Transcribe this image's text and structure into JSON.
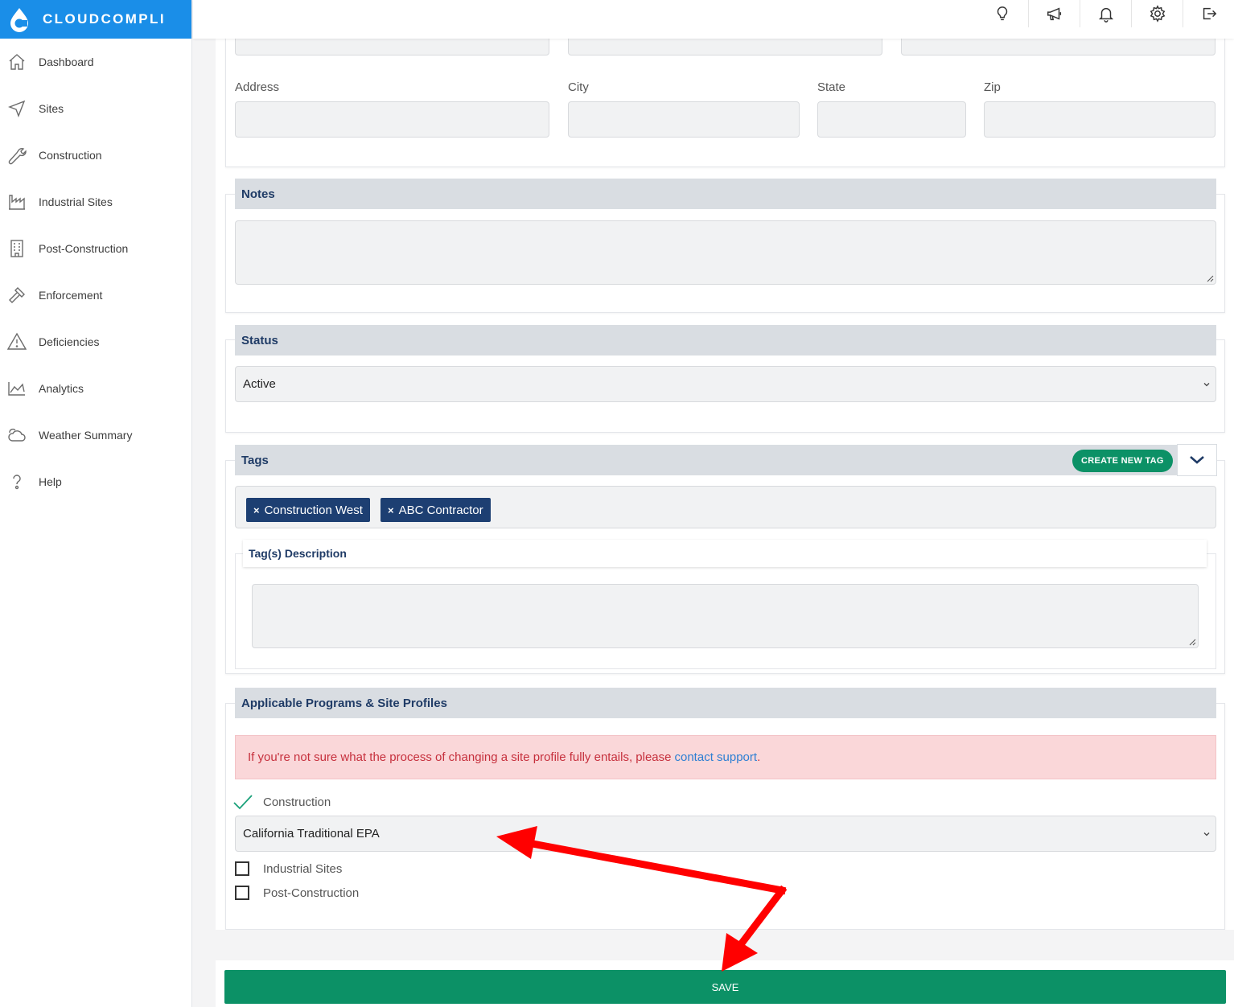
{
  "app": {
    "brand": "CLOUDCOMPLI"
  },
  "sidebar": {
    "items": [
      {
        "label": "Dashboard",
        "icon": "home-icon"
      },
      {
        "label": "Sites",
        "icon": "navigation-arrow-icon"
      },
      {
        "label": "Construction",
        "icon": "wrench-icon"
      },
      {
        "label": "Industrial Sites",
        "icon": "factory-icon"
      },
      {
        "label": "Post-Construction",
        "icon": "building-icon"
      },
      {
        "label": "Enforcement",
        "icon": "gavel-icon"
      },
      {
        "label": "Deficiencies",
        "icon": "warning-icon"
      },
      {
        "label": "Analytics",
        "icon": "chart-icon"
      },
      {
        "label": "Weather Summary",
        "icon": "cloud-icon"
      },
      {
        "label": "Help",
        "icon": "question-icon"
      }
    ]
  },
  "topbar": {
    "icons": [
      "lightbulb-icon",
      "megaphone-icon",
      "bell-icon",
      "gear-icon",
      "logout-icon"
    ]
  },
  "address": {
    "address_label": "Address",
    "city_label": "City",
    "state_label": "State",
    "zip_label": "Zip"
  },
  "notes": {
    "title": "Notes"
  },
  "status": {
    "title": "Status",
    "selected": "Active"
  },
  "tags": {
    "title": "Tags",
    "create_label": "CREATE NEW TAG",
    "chips": [
      "Construction West",
      "ABC Contractor"
    ],
    "remove_glyph": "×",
    "description_title": "Tag(s) Description"
  },
  "programs": {
    "title": "Applicable Programs & Site Profiles",
    "alert_text": "If you're not sure what the process of changing a site profile fully entails, please",
    "alert_link": "contact support",
    "alert_end": ".",
    "construction_label": "Construction",
    "construction_profile": "California Traditional EPA",
    "industrial_label": "Industrial Sites",
    "post_label": "Post-Construction"
  },
  "footer": {
    "save_label": "SAVE"
  },
  "colors": {
    "brand_blue": "#1a8ee8",
    "header_navy": "#1f3b66",
    "save_green": "#0c9166",
    "tag_navy": "#1d3f72",
    "alert_red": "#c6303d",
    "annotation_arrow": "#ff0000"
  }
}
